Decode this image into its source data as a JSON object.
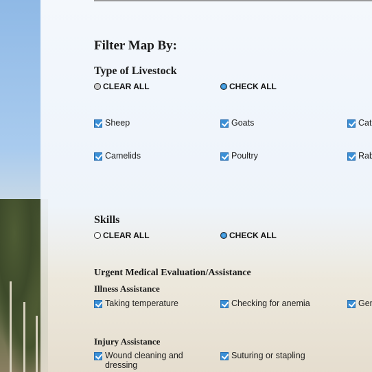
{
  "filter": {
    "title": "Filter Map By:",
    "livestock": {
      "title": "Type of Livestock",
      "clear_all": "CLEAR ALL",
      "check_all": "CHECK ALL",
      "items": [
        "Sheep",
        "Goats",
        "Cat",
        "Camelids",
        "Poultry",
        "Rab"
      ]
    },
    "skills": {
      "title": "Skills",
      "clear_all": "CLEAR ALL",
      "check_all": "CHECK ALL",
      "urgent_title": "Urgent Medical Evaluation/Assistance",
      "illness_title": "Illness Assistance",
      "illness_items": [
        "Taking temperature",
        "Checking for anemia",
        "Gen"
      ],
      "injury_title": "Injury Assistance",
      "injury_items": [
        "Wound cleaning and dressing",
        "Suturing or stapling"
      ]
    }
  },
  "colors": {
    "checkbox": "#3a8fd6",
    "radio_selected": "#2f88cf"
  },
  "icons": {
    "radio": "radio-icon",
    "checkbox": "checkbox-icon"
  }
}
